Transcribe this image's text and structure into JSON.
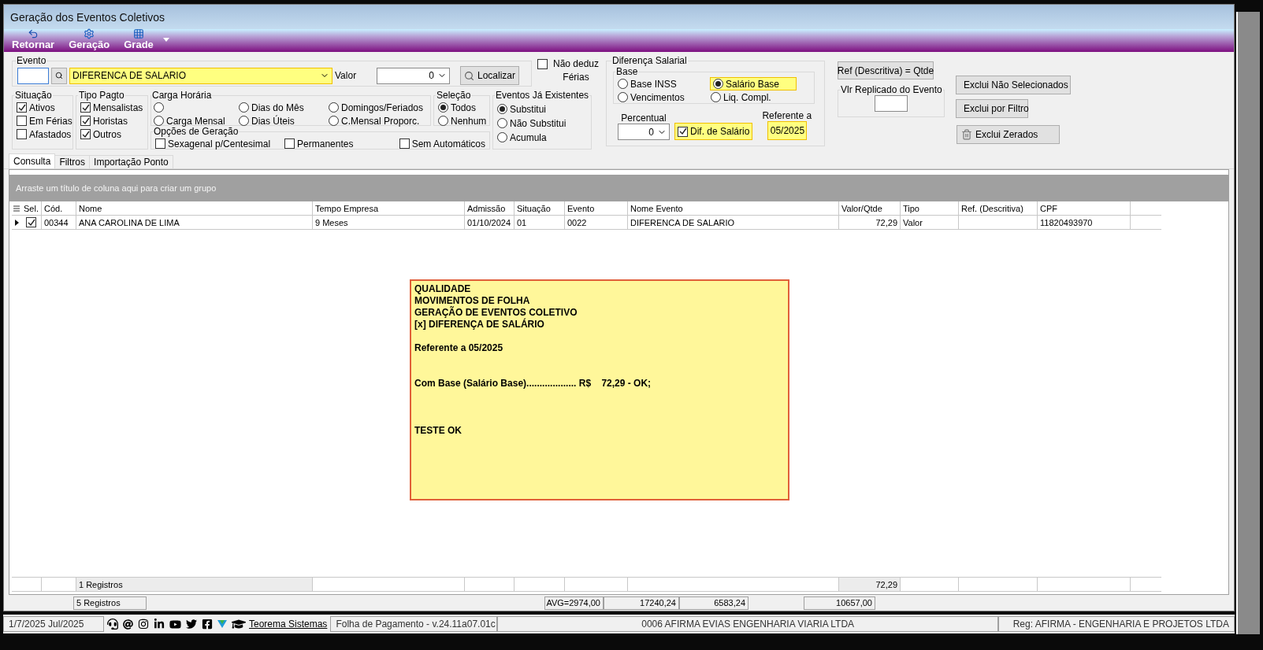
{
  "window": {
    "title": "Geração dos Eventos Coletivos"
  },
  "toolbar": {
    "buttons": [
      {
        "label": "Retornar",
        "kind": "undo"
      },
      {
        "label": "Geração",
        "kind": "gear"
      },
      {
        "label": "Grade",
        "kind": "grid"
      }
    ]
  },
  "evento": {
    "title": "Evento",
    "name": "DIFERENCA DE SALARIO",
    "highlighted": true,
    "valor_label": "Valor",
    "valor": "0",
    "search_button": "Localizar"
  },
  "nao_deduz_ferias": {
    "label": "Não deduz Férias",
    "checked": false
  },
  "situacao": {
    "title": "Situação",
    "items": [
      {
        "label": "Ativos",
        "checked": true
      },
      {
        "label": "Em Férias",
        "checked": false
      },
      {
        "label": "Afastados",
        "checked": false
      }
    ]
  },
  "tipo_pagto": {
    "title": "Tipo Pagto",
    "items": [
      {
        "label": "Mensalistas",
        "checked": true
      },
      {
        "label": "Horistas",
        "checked": true
      },
      {
        "label": "Outros",
        "checked": true
      }
    ]
  },
  "carga_horaria": {
    "title": "Carga Horária",
    "options": [
      {
        "selected": false
      },
      {
        "label": "Carga Mensal",
        "selected": false
      },
      {
        "label": "Dias do Mês",
        "selected": false
      },
      {
        "label": "Dias Úteis",
        "selected": false
      },
      {
        "label": "Domingos/Feriados",
        "selected": false
      },
      {
        "label": "C.Mensal Proporc.",
        "selected": false
      }
    ]
  },
  "selecao": {
    "title": "Seleção",
    "options": [
      {
        "label": "Todos",
        "selected": true
      },
      {
        "label": "Nenhum",
        "selected": false
      }
    ]
  },
  "opcoes_geracao": {
    "title": "Opções de Geração",
    "items": [
      {
        "label": "Sexagenal p/Centesimal",
        "checked": false
      },
      {
        "label": "Permanentes",
        "checked": false
      },
      {
        "label": "Sem Automáticos",
        "checked": false
      }
    ]
  },
  "eventos_existentes": {
    "title": "Eventos Já Existentes",
    "options": [
      {
        "label": "Substitui",
        "selected": true
      },
      {
        "label": "Não Substitui",
        "selected": false
      },
      {
        "label": "Acumula",
        "selected": false
      }
    ]
  },
  "diferenca_salarial": {
    "title": "Diferença Salarial",
    "base": {
      "title": "Base",
      "options": [
        {
          "label": "Base INSS",
          "selected": false,
          "highlighted": false
        },
        {
          "label": "Salário Base",
          "selected": true,
          "highlighted": true
        },
        {
          "label": "Vencimentos",
          "selected": false,
          "highlighted": false
        },
        {
          "label": "Liq. Compl.",
          "selected": false,
          "highlighted": false
        }
      ]
    },
    "percentual_label": "Percentual",
    "percentual": "0",
    "dif_salario": {
      "label": "Dif. de Salário",
      "checked": true,
      "highlighted": true
    },
    "referente_label": "Referente a",
    "referente": "05/2025",
    "referente_highlighted": true
  },
  "ref_button": "Ref (Descritiva) = Qtde",
  "vlr_replicado": {
    "title": "Vlr Replicado do  Evento"
  },
  "delete_buttons": [
    "Exclui Não Selecionados",
    "Exclui por Filtro",
    "Exclui Zerados"
  ],
  "tabs": [
    {
      "label": "Consulta",
      "selected": true
    },
    {
      "label": "Filtros",
      "selected": false
    },
    {
      "label": "Importação Ponto",
      "selected": false
    }
  ],
  "grid": {
    "group_hint": "Arraste um título de coluna aqui para criar um grupo",
    "sel_header": "Sel.",
    "columns": [
      {
        "label": "Cód."
      },
      {
        "label": "Nome"
      },
      {
        "label": "Tempo Empresa"
      },
      {
        "label": "Admissão"
      },
      {
        "label": "Situação"
      },
      {
        "label": "Evento"
      },
      {
        "label": "Nome Evento"
      },
      {
        "label": "Valor/Qtde",
        "kind": "number"
      },
      {
        "label": "Tipo"
      },
      {
        "label": "Ref. (Descritiva)"
      },
      {
        "label": "CPF"
      }
    ],
    "rows": [
      {
        "selected": true,
        "checked": true,
        "cells": [
          "00344",
          "ANA CAROLINA DE LIMA",
          "9 Meses",
          "01/10/2024",
          "01",
          "0022",
          "DIFERENCA DE SALARIO",
          "72,29",
          "Valor",
          null,
          "11820493970"
        ]
      }
    ],
    "footer_count": "1 Registros",
    "footer_total": "72,29"
  },
  "summary": [
    "5 Registros",
    "AVG=2974,00",
    "17240,24",
    "6583,24",
    "10657,00"
  ],
  "status_bar": {
    "date": "1/7/2025 Jul/2025",
    "link": "Teorema Sistemas",
    "app": "Folha de Pagamento - v.24.11a07.01c",
    "company": "0006 AFIRMA EVIAS ENGENHARIA VIARIA LTDA",
    "reg": "Reg: AFIRMA - ENGENHARIA E PROJETOS LTDA"
  },
  "note": {
    "blocks": [
      [
        "QUALIDADE",
        "MOVIMENTOS DE FOLHA",
        "GERAÇÃO DE EVENTOS COLETIVO",
        "[x] DIFERENÇA DE SALÁRIO"
      ],
      [
        "Referente a 05/2025"
      ],
      [
        "Com Base (Salário Base)................... R$    72,29 - OK;"
      ],
      [
        "TESTE OK"
      ]
    ]
  }
}
